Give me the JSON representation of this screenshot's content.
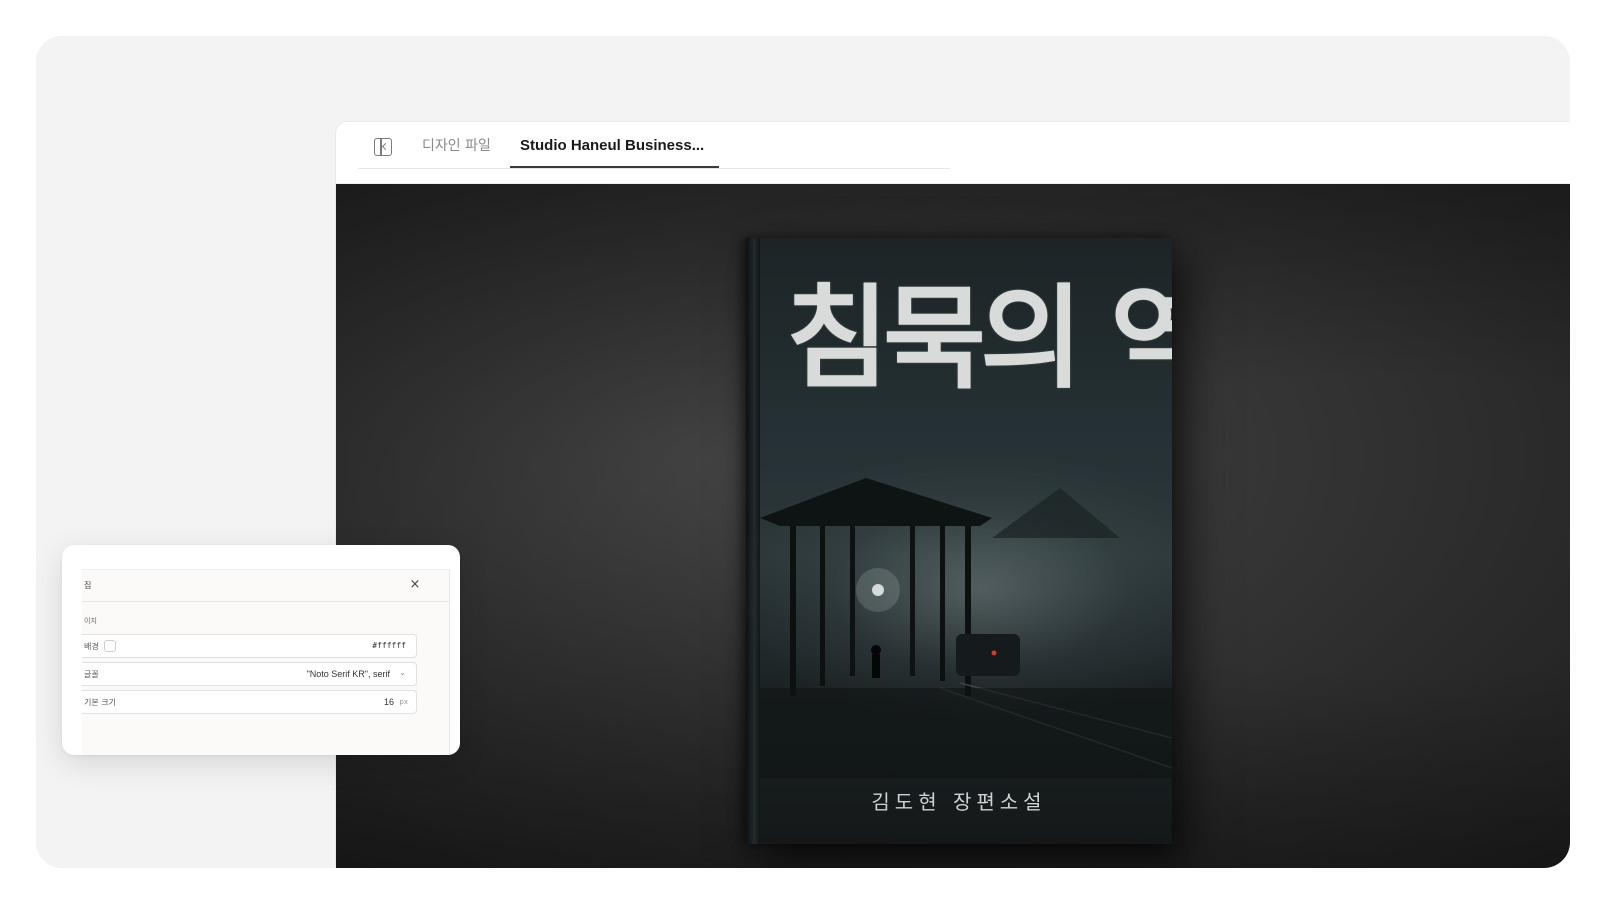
{
  "tabs": {
    "design_file": "디자인 파일",
    "active": "Studio Haneul Business..."
  },
  "book": {
    "title": "침묵의 역",
    "author": "김도현 장편소설"
  },
  "properties_panel": {
    "title": "집",
    "section": "이지",
    "background": {
      "label": "배경",
      "value": "#ffffff"
    },
    "font": {
      "label": "글꼴",
      "value": "\"Noto Serif KR\", serif"
    },
    "base_size": {
      "label": "기본 크기",
      "value": "16",
      "unit": "px"
    },
    "close": "×",
    "chevron": "⌄"
  },
  "icons": {
    "sidebar_toggle": "sidebar-toggle-icon",
    "close": "close-icon",
    "dropdown": "chevron-down-icon"
  },
  "colors": {
    "canvas_background": "#333333",
    "stage_background": "#f3f3f3",
    "book_title": "#d9dada"
  }
}
